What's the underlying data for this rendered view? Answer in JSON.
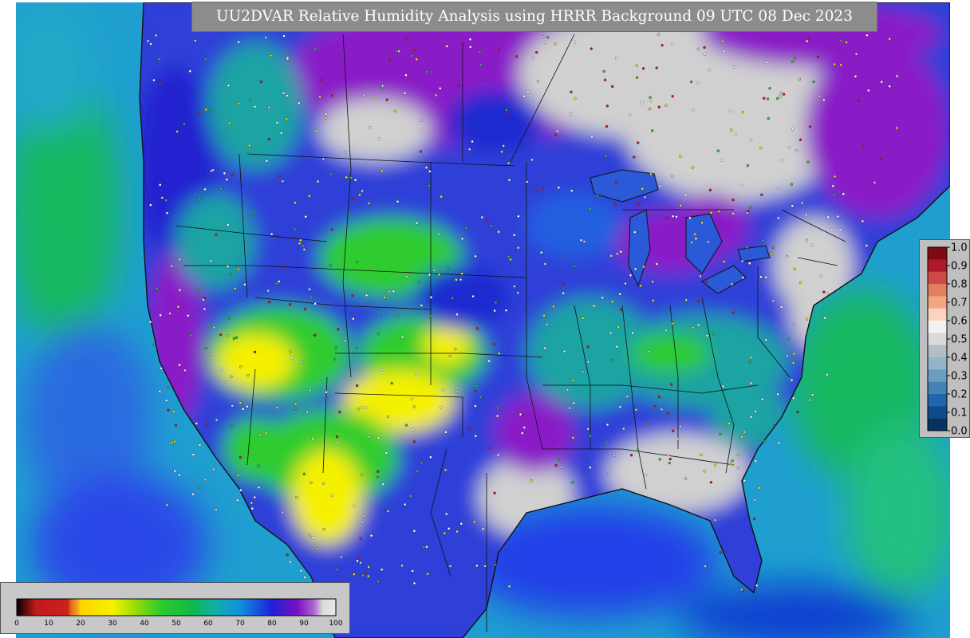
{
  "title": "UU2DVAR Relative Humidity Analysis using HRRR Background 09 UTC 08 Dec 2023",
  "colors": {
    "ocean": "#1f9fd0",
    "land_base": "#2d3fd8",
    "dry_yellow": "#f5f000",
    "green": "#2ecc2e",
    "cyan_teal": "#1aa3a3",
    "purple": "#8a1fc7",
    "saturated_gray": "#d0d0d0",
    "very_dry_red": "#c01a1a"
  },
  "icons": [
    "state-boundary-lines",
    "coastline",
    "observation-station-dots"
  ],
  "colorbar_right": {
    "caption": "",
    "ticks": [
      "1.0",
      "0.9",
      "0.8",
      "0.7",
      "0.6",
      "0.5",
      "0.4",
      "0.3",
      "0.2",
      "0.1",
      "0.0"
    ],
    "swatches": [
      "#7f0a14",
      "#b2182b",
      "#cf4a47",
      "#e08060",
      "#f4a582",
      "#fad4bd",
      "#f2f2f2",
      "#dadada",
      "#b0bec5",
      "#92b5c8",
      "#6a9ec0",
      "#4583b3",
      "#2166ac",
      "#0f4c8a",
      "#063361"
    ]
  },
  "colorbar_bottom": {
    "caption": "",
    "ticks": [
      "0",
      "10",
      "20",
      "30",
      "40",
      "50",
      "60",
      "70",
      "80",
      "90",
      "100"
    ],
    "stops": [
      {
        "at": 0,
        "color": "#000000"
      },
      {
        "at": 3,
        "color": "#6a0a0a"
      },
      {
        "at": 6,
        "color": "#c01a1a"
      },
      {
        "at": 16,
        "color": "#d02020"
      },
      {
        "at": 17,
        "color": "#e86a1a"
      },
      {
        "at": 19,
        "color": "#f0a020"
      },
      {
        "at": 20,
        "color": "#ffd400"
      },
      {
        "at": 30,
        "color": "#f7f000"
      },
      {
        "at": 36,
        "color": "#a8e000"
      },
      {
        "at": 45,
        "color": "#2ccc2c"
      },
      {
        "at": 55,
        "color": "#10b848"
      },
      {
        "at": 62,
        "color": "#10b0a8"
      },
      {
        "at": 70,
        "color": "#1090e0"
      },
      {
        "at": 80,
        "color": "#2020d8"
      },
      {
        "at": 88,
        "color": "#7a10c0"
      },
      {
        "at": 93,
        "color": "#b060d0"
      },
      {
        "at": 96,
        "color": "#dcdcdc"
      },
      {
        "at": 100,
        "color": "#e8e8e8"
      }
    ]
  }
}
